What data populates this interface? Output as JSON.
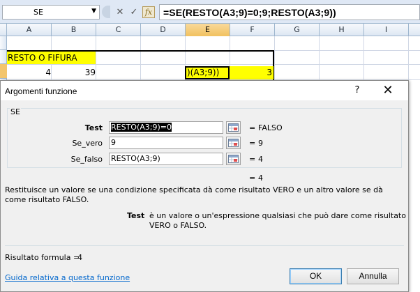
{
  "formula_bar": {
    "name_box": "SE",
    "name_box_arrow": "▼",
    "cancel_glyph": "✕",
    "enter_glyph": "✓",
    "insert_function_glyph": "fx",
    "formula": "=SE(RESTO(A3;9)=0;9;RESTO(A3;9))"
  },
  "sheet": {
    "columns": [
      "A",
      "B",
      "C",
      "D",
      "E",
      "F",
      "G",
      "H",
      "I"
    ],
    "selected_column": "E",
    "title_cell": "RESTO O FIFURA",
    "row_values": {
      "A": "4",
      "B": "39",
      "E": ")(A3;9))",
      "F": "3"
    },
    "highlight_color": "#ffff00"
  },
  "dialog": {
    "title": "Argomenti funzione",
    "help_glyph": "?",
    "close_glyph": "✕",
    "function_name": "SE",
    "args": [
      {
        "label": "Test",
        "value_selected": "RESTO(A3;9)=0",
        "equals": "=",
        "result": "FALSO"
      },
      {
        "label": "Se_vero",
        "value": "9",
        "equals": "=",
        "result": "9"
      },
      {
        "label": "Se_falso",
        "value": "RESTO(A3;9)",
        "equals": "=",
        "result": "4"
      }
    ],
    "overall_equals": "=",
    "overall_result": "4",
    "description": "Restituisce un valore se una condizione specificata dà come risultato VERO e un altro valore se dà come risultato FALSO.",
    "arg_desc_name": "Test",
    "arg_desc_text": "è un valore o un'espressione qualsiasi che può dare come risultato VERO o FALSO.",
    "result_label": "Risultato formula =",
    "result_value": "4",
    "help_link": "Guida relativa a questa funzione",
    "ok_label": "OK",
    "cancel_label": "Annulla"
  },
  "icons": {
    "ref_button": "collapse-dialog-icon",
    "help": "help-icon",
    "close": "close-icon"
  }
}
